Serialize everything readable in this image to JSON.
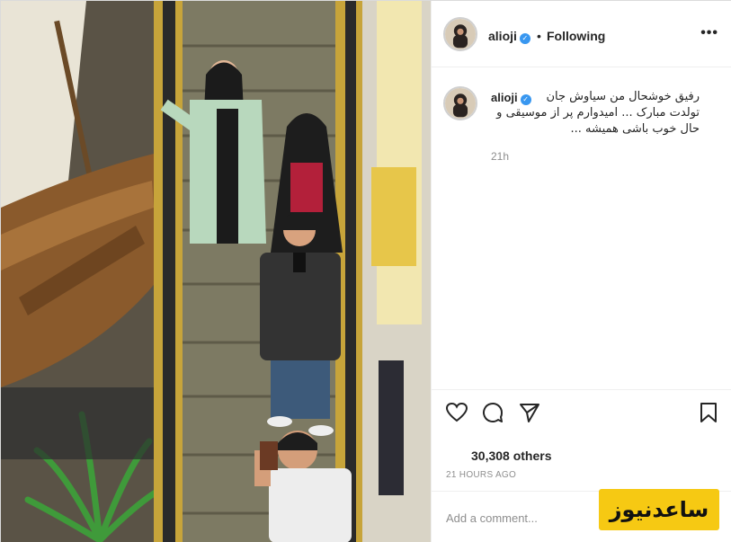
{
  "post": {
    "username": "alioji",
    "verified_icon": "verified-badge-icon",
    "separator": "•",
    "follow_state": "Following",
    "more_icon": "more-options-icon",
    "more_glyph": "•••"
  },
  "caption": {
    "username": "alioji",
    "lines": [
      "رفیق خوشحال من سیاوش جان",
      "تولدت مبارک ... امیدوارم پر از موسیقی و",
      "حال خوب باشی همیشه ..."
    ],
    "time": "21h"
  },
  "actions": {
    "icons": [
      "heart-icon",
      "comment-icon",
      "share-icon",
      "bookmark-icon"
    ]
  },
  "likes": {
    "text": "30,308 others"
  },
  "timestamp": "21 HOURS AGO",
  "comment": {
    "placeholder": "Add a comment..."
  },
  "watermark": {
    "text": "ساعدنیوز"
  },
  "colors": {
    "verified": "#3897f0",
    "watermark_bg": "#f6c913",
    "muted_text": "#8e8e8e",
    "border": "#efefef"
  }
}
